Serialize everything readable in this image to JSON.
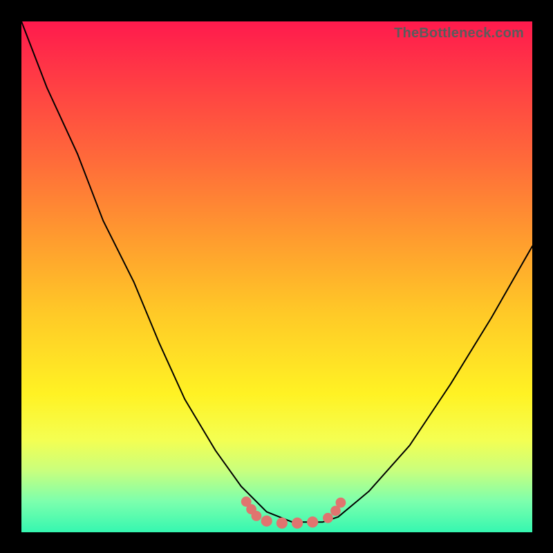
{
  "watermark": "TheBottleneck.com",
  "chart_data": {
    "type": "line",
    "title": "",
    "xlabel": "",
    "ylabel": "",
    "xlim": [
      0,
      1
    ],
    "ylim": [
      0,
      1
    ],
    "grid": false,
    "legend": false,
    "series": [
      {
        "name": "curve",
        "x": [
          0.0,
          0.05,
          0.11,
          0.16,
          0.22,
          0.27,
          0.32,
          0.38,
          0.43,
          0.48,
          0.53,
          0.56,
          0.59,
          0.62,
          0.68,
          0.76,
          0.84,
          0.92,
          1.0
        ],
        "values": [
          1.0,
          0.87,
          0.74,
          0.61,
          0.49,
          0.37,
          0.26,
          0.16,
          0.09,
          0.04,
          0.02,
          0.02,
          0.02,
          0.03,
          0.08,
          0.17,
          0.29,
          0.42,
          0.56
        ]
      }
    ],
    "markers": [
      {
        "x": 0.44,
        "y": 0.06,
        "r": 0.01
      },
      {
        "x": 0.45,
        "y": 0.045,
        "r": 0.01
      },
      {
        "x": 0.46,
        "y": 0.032,
        "r": 0.01
      },
      {
        "x": 0.48,
        "y": 0.022,
        "r": 0.011
      },
      {
        "x": 0.51,
        "y": 0.018,
        "r": 0.011
      },
      {
        "x": 0.54,
        "y": 0.018,
        "r": 0.011
      },
      {
        "x": 0.57,
        "y": 0.02,
        "r": 0.011
      },
      {
        "x": 0.6,
        "y": 0.028,
        "r": 0.01
      },
      {
        "x": 0.615,
        "y": 0.042,
        "r": 0.01
      },
      {
        "x": 0.625,
        "y": 0.058,
        "r": 0.01
      }
    ],
    "marker_color": "#e0746f",
    "background_gradient": [
      "#ff1a4d",
      "#ffc927",
      "#fff224",
      "#35f7b0"
    ]
  }
}
